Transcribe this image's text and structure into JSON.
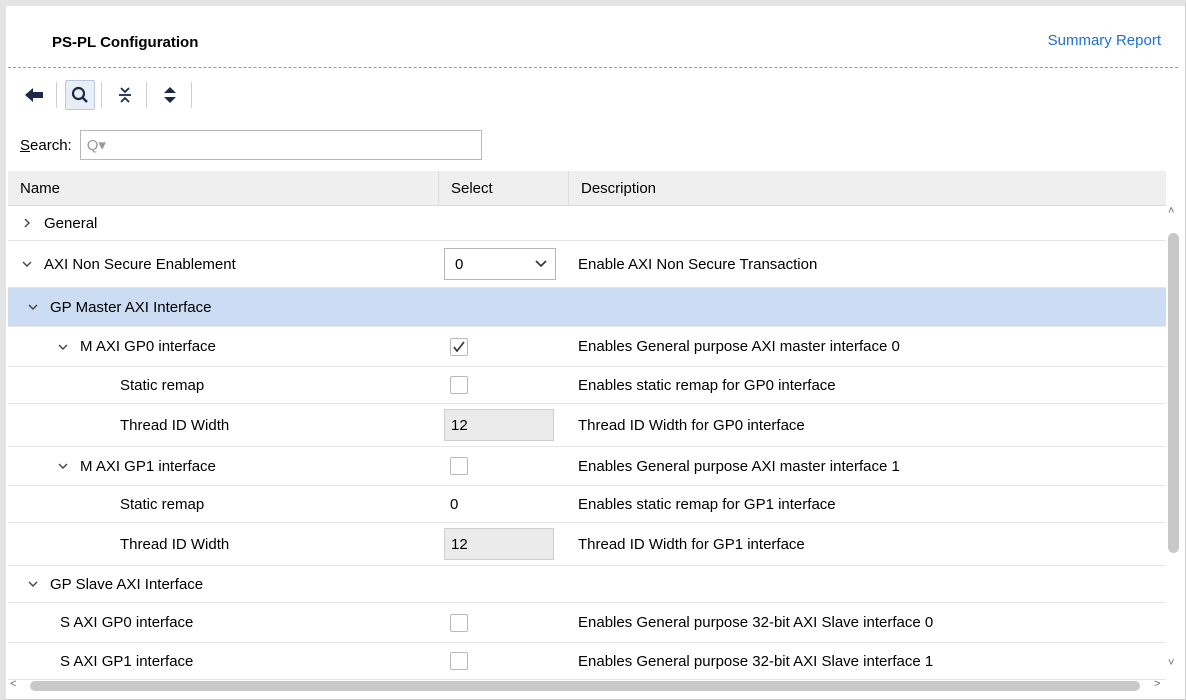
{
  "header": {
    "title": "PS-PL Configuration",
    "summary_link": "Summary Report"
  },
  "toolbar": {
    "icons": [
      "back-arrow-icon",
      "search-icon",
      "collapse-all-icon",
      "expand-all-icon"
    ]
  },
  "search": {
    "label_prefix": "S",
    "label_rest": "earch:",
    "placeholder": "Q▾"
  },
  "table": {
    "columns": [
      "Name",
      "Select",
      "Description"
    ],
    "rows": [
      {
        "name": "General",
        "desc": ""
      },
      {
        "name": "AXI Non Secure Enablement",
        "select": "0",
        "desc": "Enable AXI Non Secure Transaction"
      },
      {
        "name": "GP Master AXI Interface",
        "desc": ""
      },
      {
        "name": "M AXI GP0 interface",
        "checked": true,
        "desc": "Enables General purpose AXI master interface 0"
      },
      {
        "name": "Static remap",
        "checked": false,
        "desc": "Enables static remap for GP0 interface"
      },
      {
        "name": "Thread ID Width",
        "value": "12",
        "desc": "Thread ID Width for GP0 interface"
      },
      {
        "name": "M AXI GP1 interface",
        "checked": false,
        "desc": "Enables General purpose AXI master interface 1"
      },
      {
        "name": "Static remap",
        "value": "0",
        "desc": "Enables static remap for GP1 interface"
      },
      {
        "name": "Thread ID Width",
        "value": "12",
        "desc": "Thread ID Width for GP1 interface"
      },
      {
        "name": "GP Slave AXI Interface",
        "desc": ""
      },
      {
        "name": "S AXI GP0 interface",
        "checked": false,
        "desc": "Enables General purpose 32-bit AXI Slave interface 0"
      },
      {
        "name": "S AXI GP1 interface",
        "checked": false,
        "desc": "Enables General purpose 32-bit AXI Slave interface 1"
      }
    ]
  },
  "colors": {
    "selected_row": "#cbdcf3",
    "link": "#1f6fd1"
  }
}
